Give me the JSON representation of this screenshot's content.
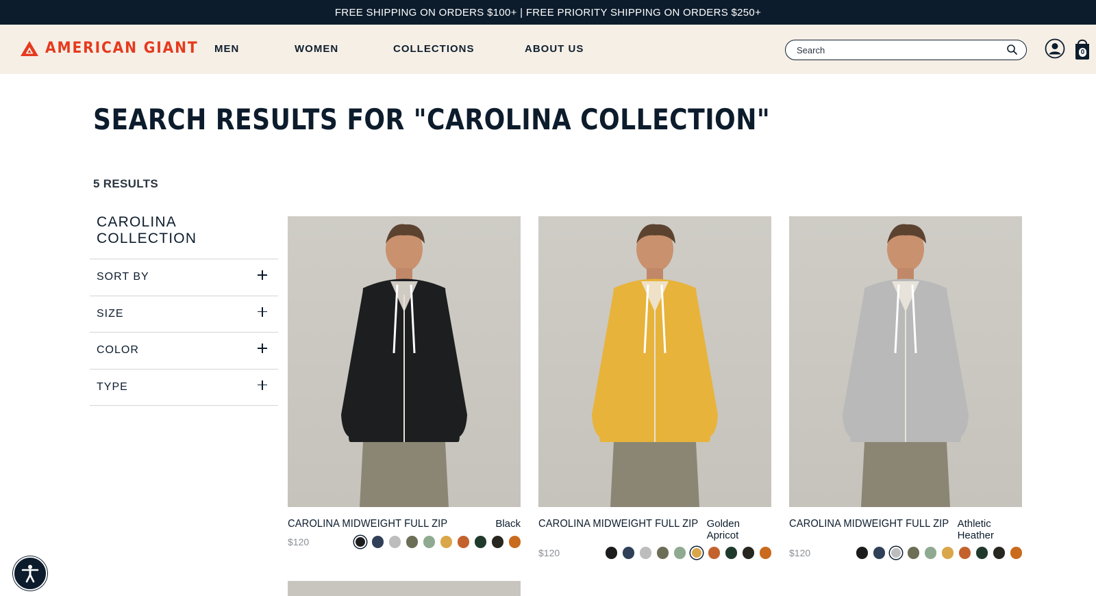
{
  "promo": {
    "text": "FREE SHIPPING ON ORDERS $100+ | FREE PRIORITY SHIPPING ON ORDERS $250+"
  },
  "header": {
    "logo_text": "AMERICAN GIANT",
    "nav": [
      "MEN",
      "WOMEN",
      "COLLECTIONS",
      "ABOUT US"
    ],
    "search": {
      "placeholder": "Search",
      "value": ""
    },
    "bag_count": "0"
  },
  "page": {
    "title": "SEARCH RESULTS FOR \"CAROLINA COLLECTION\"",
    "results_count": "5 RESULTS"
  },
  "sidebar": {
    "heading": "CAROLINA COLLECTION",
    "filters": [
      "SORT BY",
      "SIZE",
      "COLOR",
      "TYPE"
    ]
  },
  "products": [
    {
      "name": "CAROLINA MIDWEIGHT FULL ZIP",
      "color": "Black",
      "price": "$120",
      "hoodie_color": "#1d1e20",
      "swatches": [
        "#1c1c1c",
        "#2f4058",
        "#bdbdbd",
        "#6c6e56",
        "#8faa91",
        "#d9a64a",
        "#c4622d",
        "#1f3a2c",
        "#27261f",
        "#c96a1c"
      ],
      "selected_swatch": 0
    },
    {
      "name": "CAROLINA MIDWEIGHT FULL ZIP",
      "color": "Golden Apricot",
      "price": "$120",
      "hoodie_color": "#e7b33b",
      "swatches": [
        "#1c1c1c",
        "#2f4058",
        "#bdbdbd",
        "#6c6e56",
        "#8faa91",
        "#d9a64a",
        "#c4622d",
        "#1f3a2c",
        "#27261f",
        "#c96a1c"
      ],
      "selected_swatch": 5
    },
    {
      "name": "CAROLINA MIDWEIGHT FULL ZIP",
      "color": "Athletic Heather",
      "price": "$120",
      "hoodie_color": "#b9b9b9",
      "swatches": [
        "#1c1c1c",
        "#2f4058",
        "#bdbdbd",
        "#6c6e56",
        "#8faa91",
        "#d9a64a",
        "#c4622d",
        "#1f3a2c",
        "#27261f",
        "#c96a1c"
      ],
      "selected_swatch": 2
    }
  ],
  "colors": {
    "brand_red": "#e53a1e",
    "navy": "#0c1c2c",
    "header_bg": "#f6efe6"
  },
  "icons": {
    "logo": "triangle-logo-icon",
    "search": "search-icon",
    "account": "account-icon",
    "bag": "bag-icon",
    "accessibility": "accessibility-icon",
    "filter_expand": "plus-icon"
  }
}
